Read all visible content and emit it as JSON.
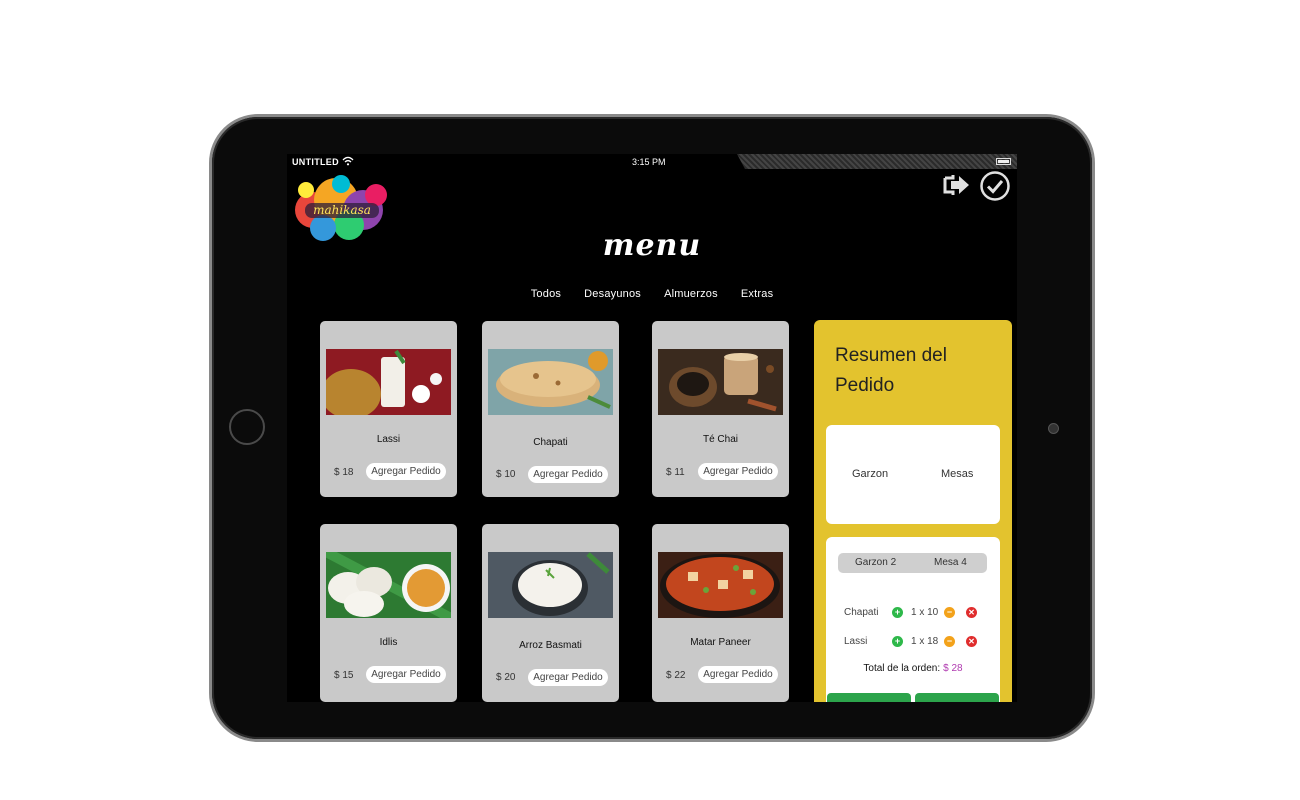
{
  "statusbar": {
    "carrier": "UNTITLED",
    "time": "3:15 PM"
  },
  "logo": {
    "text": "mahikasa"
  },
  "header": {
    "title": "menu"
  },
  "tabs": [
    "Todos",
    "Desayunos",
    "Almuerzos",
    "Extras"
  ],
  "products": [
    {
      "name": "Lassi",
      "price": "$  18",
      "action": "Agregar Pedido"
    },
    {
      "name": "Chapati",
      "price": "$  10",
      "action": "Agregar Pedido"
    },
    {
      "name": "Té Chai",
      "price": "$  11",
      "action": "Agregar Pedido"
    },
    {
      "name": "Idlis",
      "price": "$  15",
      "action": "Agregar Pedido"
    },
    {
      "name": "Arroz Basmati",
      "price": "$  20",
      "action": "Agregar Pedido"
    },
    {
      "name": "Matar Paneer",
      "price": "$  22",
      "action": "Agregar Pedido"
    }
  ],
  "summary": {
    "title": "Resumen del Pedido",
    "waiter_select": "Garzon",
    "table_select": "Mesas",
    "selected_waiter": "Garzon 2",
    "selected_table": "Mesa 4",
    "lines": [
      {
        "item": "Chapati",
        "qty": "1 x 10"
      },
      {
        "item": "Lassi",
        "qty": "1 x 18"
      }
    ],
    "total_label": "Total de la orden:",
    "total_value": "$  28"
  },
  "colors": {
    "summary_bg": "#e3c32e",
    "card_bg": "#c9c9c9",
    "confirm_green": "#2ca44b",
    "total_accent": "#b03ab0"
  },
  "icons": [
    "wifi-icon",
    "battery-icon",
    "logout-icon",
    "check-circle-icon",
    "plus-icon",
    "minus-icon",
    "delete-icon"
  ]
}
